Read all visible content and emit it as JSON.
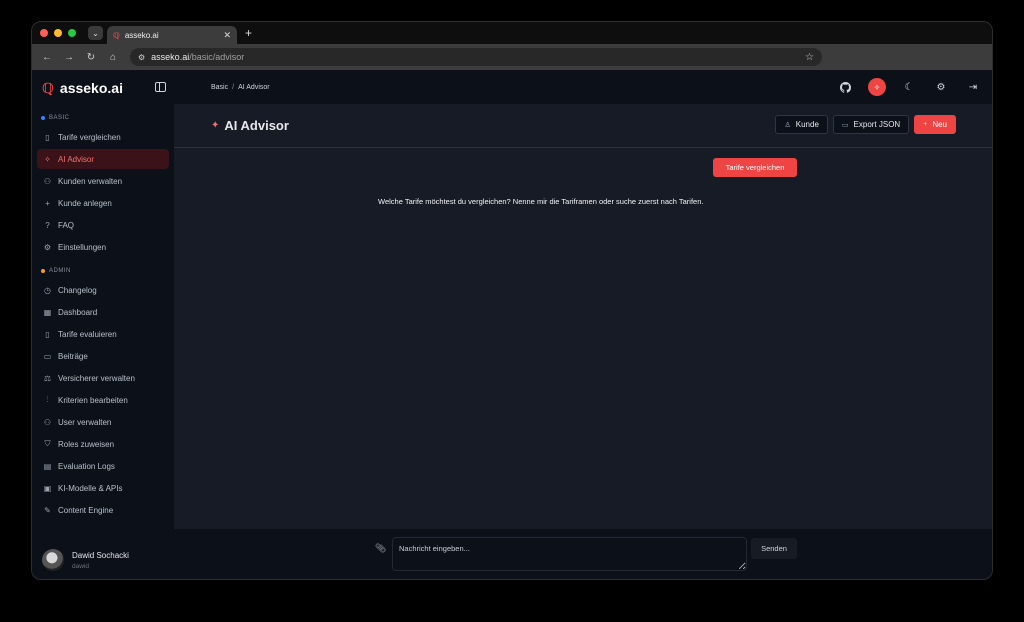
{
  "browser": {
    "tab_title": "asseko.ai",
    "url_host": "asseko.ai",
    "url_path": "/basic/advisor",
    "traffic_lights": [
      "#ff5f57",
      "#febc2e",
      "#28c840"
    ]
  },
  "brand": {
    "name": "asseko.ai",
    "accent": "#ef4444"
  },
  "sidebar": {
    "basic_label": "BASIC",
    "basic_dot": "#3b82f6",
    "basic_items": [
      {
        "label": "Tarife vergleichen",
        "icon": "document-icon"
      },
      {
        "label": "AI Advisor",
        "icon": "sparkles-icon",
        "active": true
      },
      {
        "label": "Kunden verwalten",
        "icon": "users-icon"
      },
      {
        "label": "Kunde anlegen",
        "icon": "plus-icon"
      },
      {
        "label": "FAQ",
        "icon": "help-circle-icon"
      },
      {
        "label": "Einstellungen",
        "icon": "settings-icon"
      }
    ],
    "admin_label": "ADMIN",
    "admin_dot": "#f59e0b",
    "admin_items": [
      {
        "label": "Changelog",
        "icon": "history-icon"
      },
      {
        "label": "Dashboard",
        "icon": "grid-icon"
      },
      {
        "label": "Tarife evaluieren",
        "icon": "file-check-icon"
      },
      {
        "label": "Beiträge",
        "icon": "receipt-icon"
      },
      {
        "label": "Versicherer verwalten",
        "icon": "scale-icon"
      },
      {
        "label": "Kriterien bearbeiten",
        "icon": "sliders-icon"
      },
      {
        "label": "User verwalten",
        "icon": "user-group-icon"
      },
      {
        "label": "Roles zuweisen",
        "icon": "shield-icon"
      },
      {
        "label": "Evaluation Logs",
        "icon": "log-file-icon"
      },
      {
        "label": "KI-Modelle & APIs",
        "icon": "chip-icon"
      },
      {
        "label": "Content Engine",
        "icon": "edit-icon"
      }
    ],
    "user": {
      "name": "Dawid Sochacki",
      "handle": "dawid"
    }
  },
  "topbar": {
    "crumb_root": "Basic",
    "crumb_sep": "/",
    "crumb_current": "AI Advisor"
  },
  "header": {
    "title": "AI Advisor",
    "kunde_label": "Kunde",
    "export_label": "Export JSON",
    "new_label": "Neu"
  },
  "chat": {
    "user_message": "Tarife vergleichen",
    "assistant_message": "Welche Tarife möchtest du vergleichen? Nenne mir die Tariframen oder suche zuerst nach Tarifen."
  },
  "composer": {
    "placeholder": "Nachricht eingeben...",
    "send_label": "Senden"
  }
}
